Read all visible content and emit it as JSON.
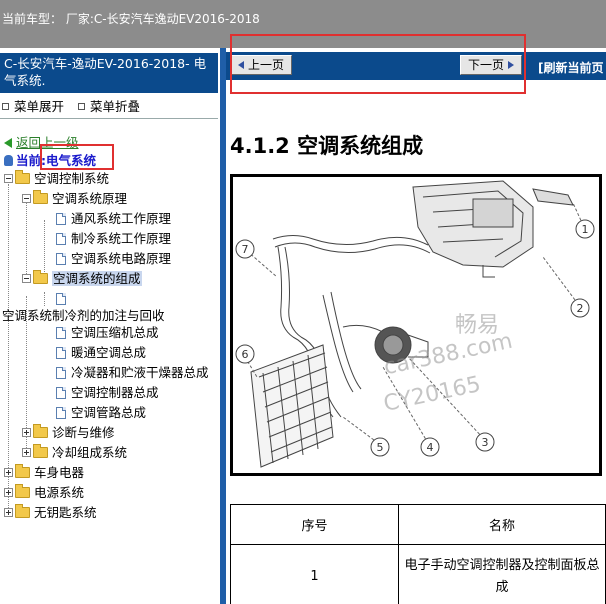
{
  "topbar": {
    "text": "当前车型：  厂家:C-长安汽车逸动EV2016-2018"
  },
  "sidebar": {
    "header": "C-长安汽车-逸动EV-2016-2018- 电气系统.",
    "expand_label": "菜单展开",
    "collapse_label": "菜单折叠",
    "back_label": "返回上一级",
    "current_prefix": "当前:",
    "current_value": "电气系统",
    "tree": {
      "n1": "空调控制系统",
      "n2": "空调系统原理",
      "n3": "通风系统工作原理",
      "n4": "制冷系统工作原理",
      "n5": "空调系统电路原理",
      "n6": "空调系统的组成",
      "n7": "",
      "n8": "空调系统制冷剂的加注与回收",
      "n9": "空调压缩机总成",
      "n10": "暖通空调总成",
      "n11": "冷凝器和贮液干燥器总成",
      "n12": "空调控制器总成",
      "n13": "空调管路总成",
      "n14": "诊断与维修",
      "n15": "冷却组成系统",
      "n16": "车身电器",
      "n17": "电源系统",
      "n18": "无钥匙系统"
    }
  },
  "main": {
    "prev_label": "上一页",
    "next_label": "下一页",
    "refresh_label": "[刷新当前页",
    "heading": "4.1.2 空调系统组成",
    "figure": {
      "callouts": [
        "1",
        "2",
        "3",
        "4",
        "5",
        "6",
        "7"
      ],
      "watermark_1": "畅易",
      "watermark_2": "car388.com",
      "watermark_3": "CY20165"
    },
    "table": {
      "headers": [
        "序号",
        "名称"
      ],
      "rows": [
        [
          "1",
          "电子手动空调控制器及控制面板总成"
        ]
      ]
    }
  },
  "colors": {
    "topbar": "#8c8c8c",
    "header_blue": "#0b4a8c",
    "highlight_red": "#e03030",
    "folder_yellow": "#f2c84a"
  }
}
